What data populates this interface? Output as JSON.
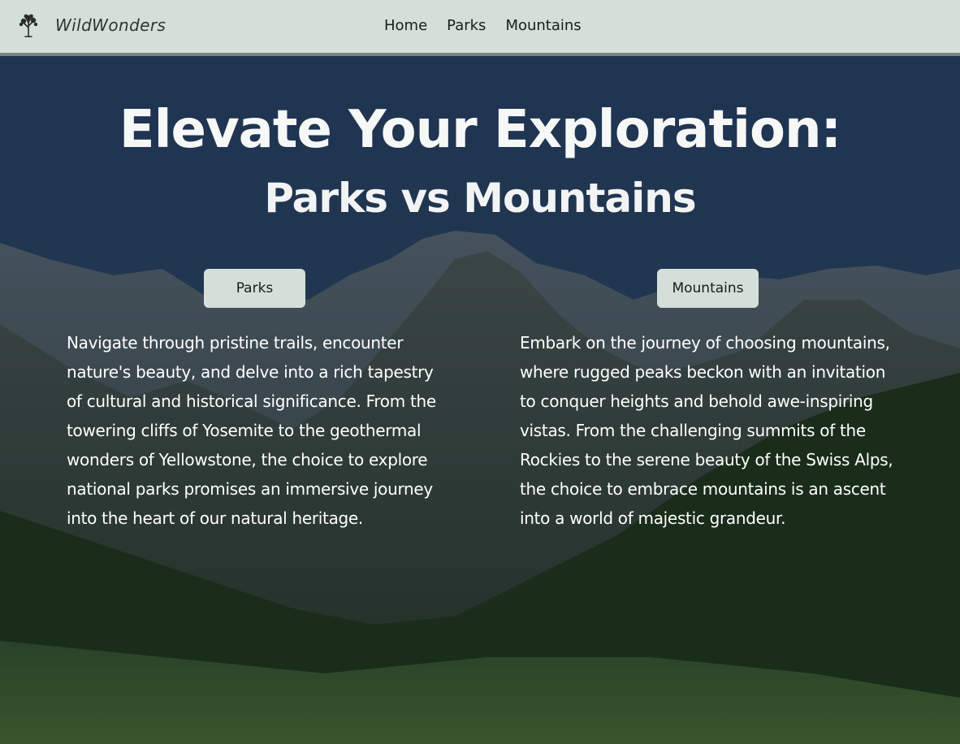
{
  "nav": {
    "brand": "WildWonders",
    "links": [
      "Home",
      "Parks",
      "Mountains"
    ]
  },
  "hero": {
    "title": "Elevate Your Exploration:",
    "subtitle": "Parks vs Mountains"
  },
  "tabs": {
    "parks": {
      "label": "Parks",
      "text": "Navigate through pristine trails, encounter nature's beauty, and delve into a rich tapestry of cultural and historical significance. From the towering cliffs of Yosemite to the geothermal wonders of Yellowstone, the choice to explore national parks promises an immersive journey into the heart of our natural heritage."
    },
    "mountains": {
      "label": "Mountains",
      "text": "Embark on the journey of choosing mountains, where rugged peaks beckon with an invitation to conquer heights and behold awe-inspiring vistas. From the challenging summits of the Rockies to the serene beauty of the Swiss Alps, the choice to embrace mountains is an ascent into a world of majestic grandeur."
    }
  },
  "icons": {
    "brand": "tree-icon"
  },
  "colors": {
    "nav_bg": "#d3dfd8",
    "nav_divider": "#7a8580",
    "button_bg": "#d3dfd8",
    "heading_text": "#f6f7f7",
    "body_text": "#ffffff"
  }
}
